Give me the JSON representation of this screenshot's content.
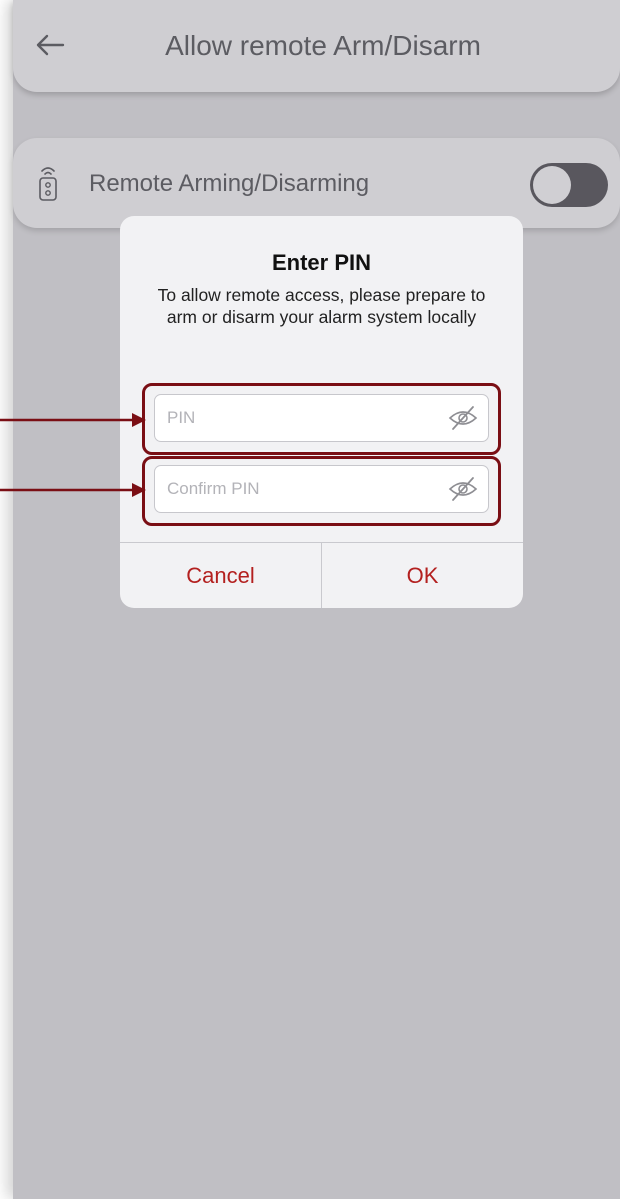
{
  "header": {
    "title": "Allow remote Arm/Disarm",
    "back_icon": "arrow-left-icon"
  },
  "setting": {
    "label": "Remote Arming/Disarming",
    "icon": "remote-control-icon",
    "toggle_on": false
  },
  "dialog": {
    "title": "Enter PIN",
    "message": "To allow remote access, please prepare to arm or disarm your alarm system locally",
    "pin_field": {
      "placeholder": "PIN",
      "value": "",
      "icon": "eye-slash-icon"
    },
    "confirm_field": {
      "placeholder": "Confirm PIN",
      "value": "",
      "icon": "eye-slash-icon"
    },
    "cancel_label": "Cancel",
    "ok_label": "OK"
  },
  "colors": {
    "accent": "#b3201f",
    "callout": "#7a0e14",
    "overlay_background": "#c0bfc4",
    "dialog_background": "#f2f2f4"
  }
}
